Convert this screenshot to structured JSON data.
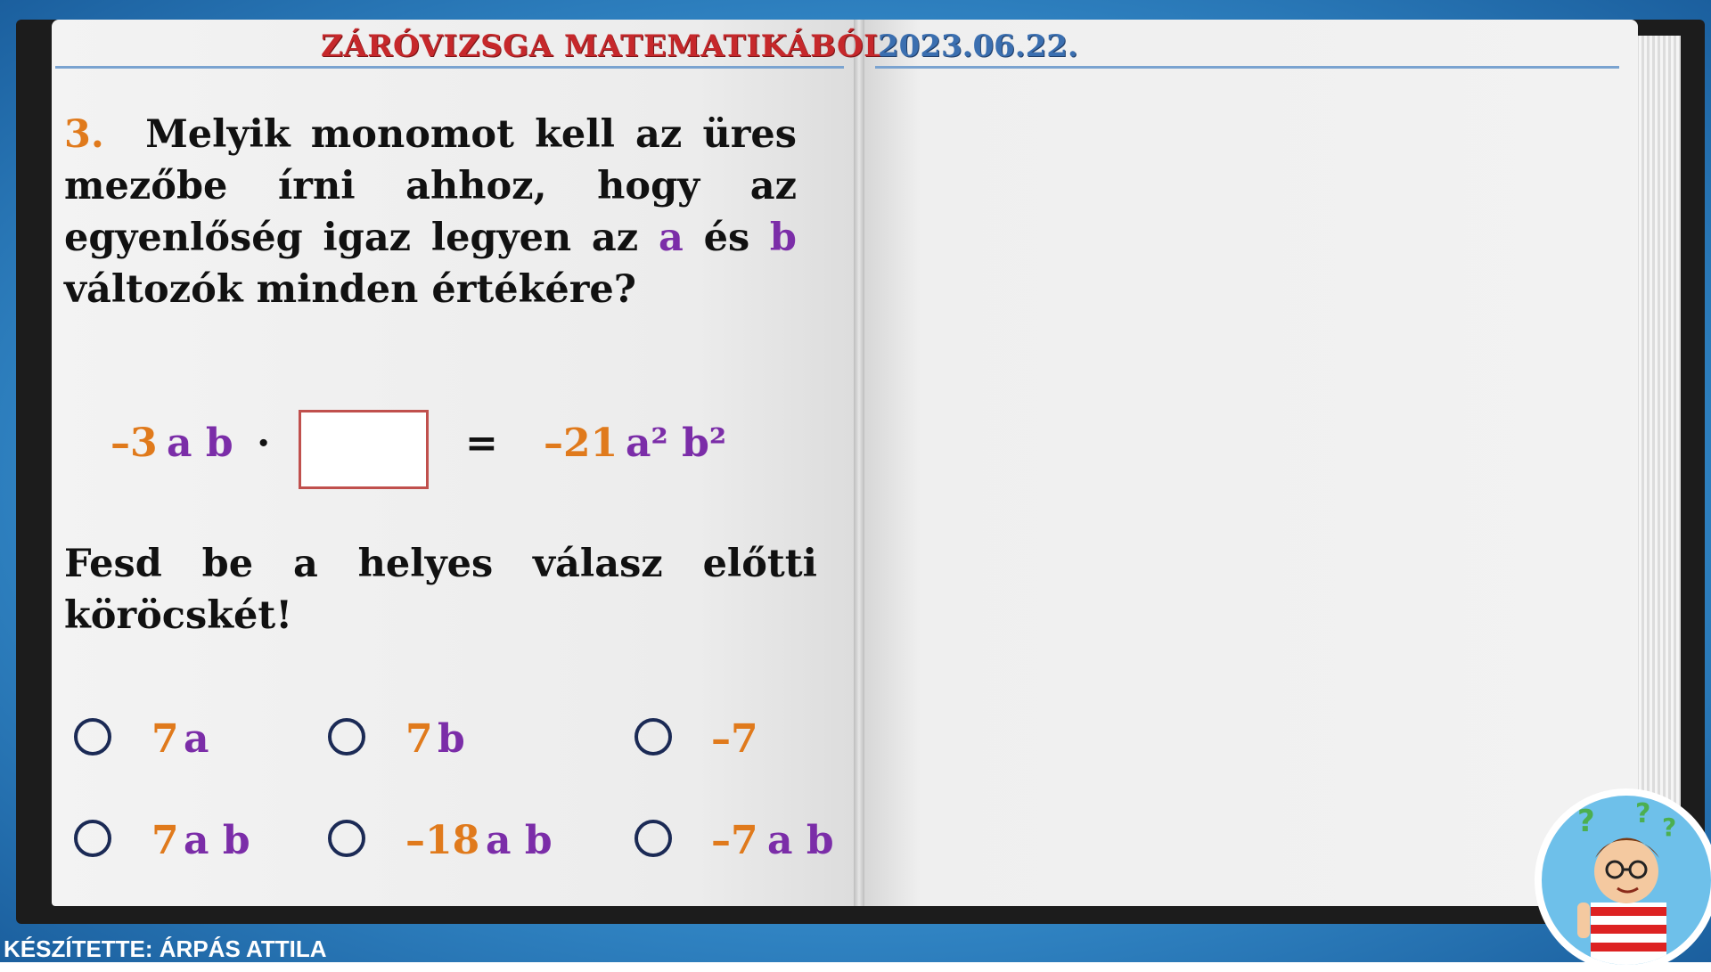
{
  "header": {
    "title": "ZÁRÓVIZSGA MATEMATIKÁBÓL",
    "date": "2023.06.22."
  },
  "question": {
    "number": "3.",
    "text_part1": "Melyik monomot kell az üres mezőbe írni ahhoz, hogy az egyenlőség igaz legyen az",
    "var_a": "a",
    "conjunction": "és",
    "var_b": "b",
    "text_part2": "változók minden értékére?"
  },
  "equation": {
    "left_coef": "–3",
    "left_vars": "a b",
    "operator": "·",
    "equals": "=",
    "right_coef": "–21",
    "right_vars": "a² b²"
  },
  "instruction": "Fesd be a helyes válasz előtti köröcskét!",
  "options": [
    {
      "coef": "7",
      "vars": "a"
    },
    {
      "coef": "7",
      "vars": "b"
    },
    {
      "coef": "–7",
      "vars": ""
    },
    {
      "coef": "7",
      "vars": "a b"
    },
    {
      "coef": "–18",
      "vars": "a b"
    },
    {
      "coef": "–7",
      "vars": "a b"
    }
  ],
  "footer": "KÉSZÍTETTE: ÁRPÁS ATTILA",
  "colors": {
    "accent_orange": "#e07a1c",
    "accent_purple": "#7b2da8",
    "title_red": "#c6282b",
    "date_blue": "#3b6fb0",
    "box_border": "#c0504d"
  },
  "icons": {
    "radio": "empty-circle",
    "mascot": "thinking-boy-with-question-marks"
  }
}
